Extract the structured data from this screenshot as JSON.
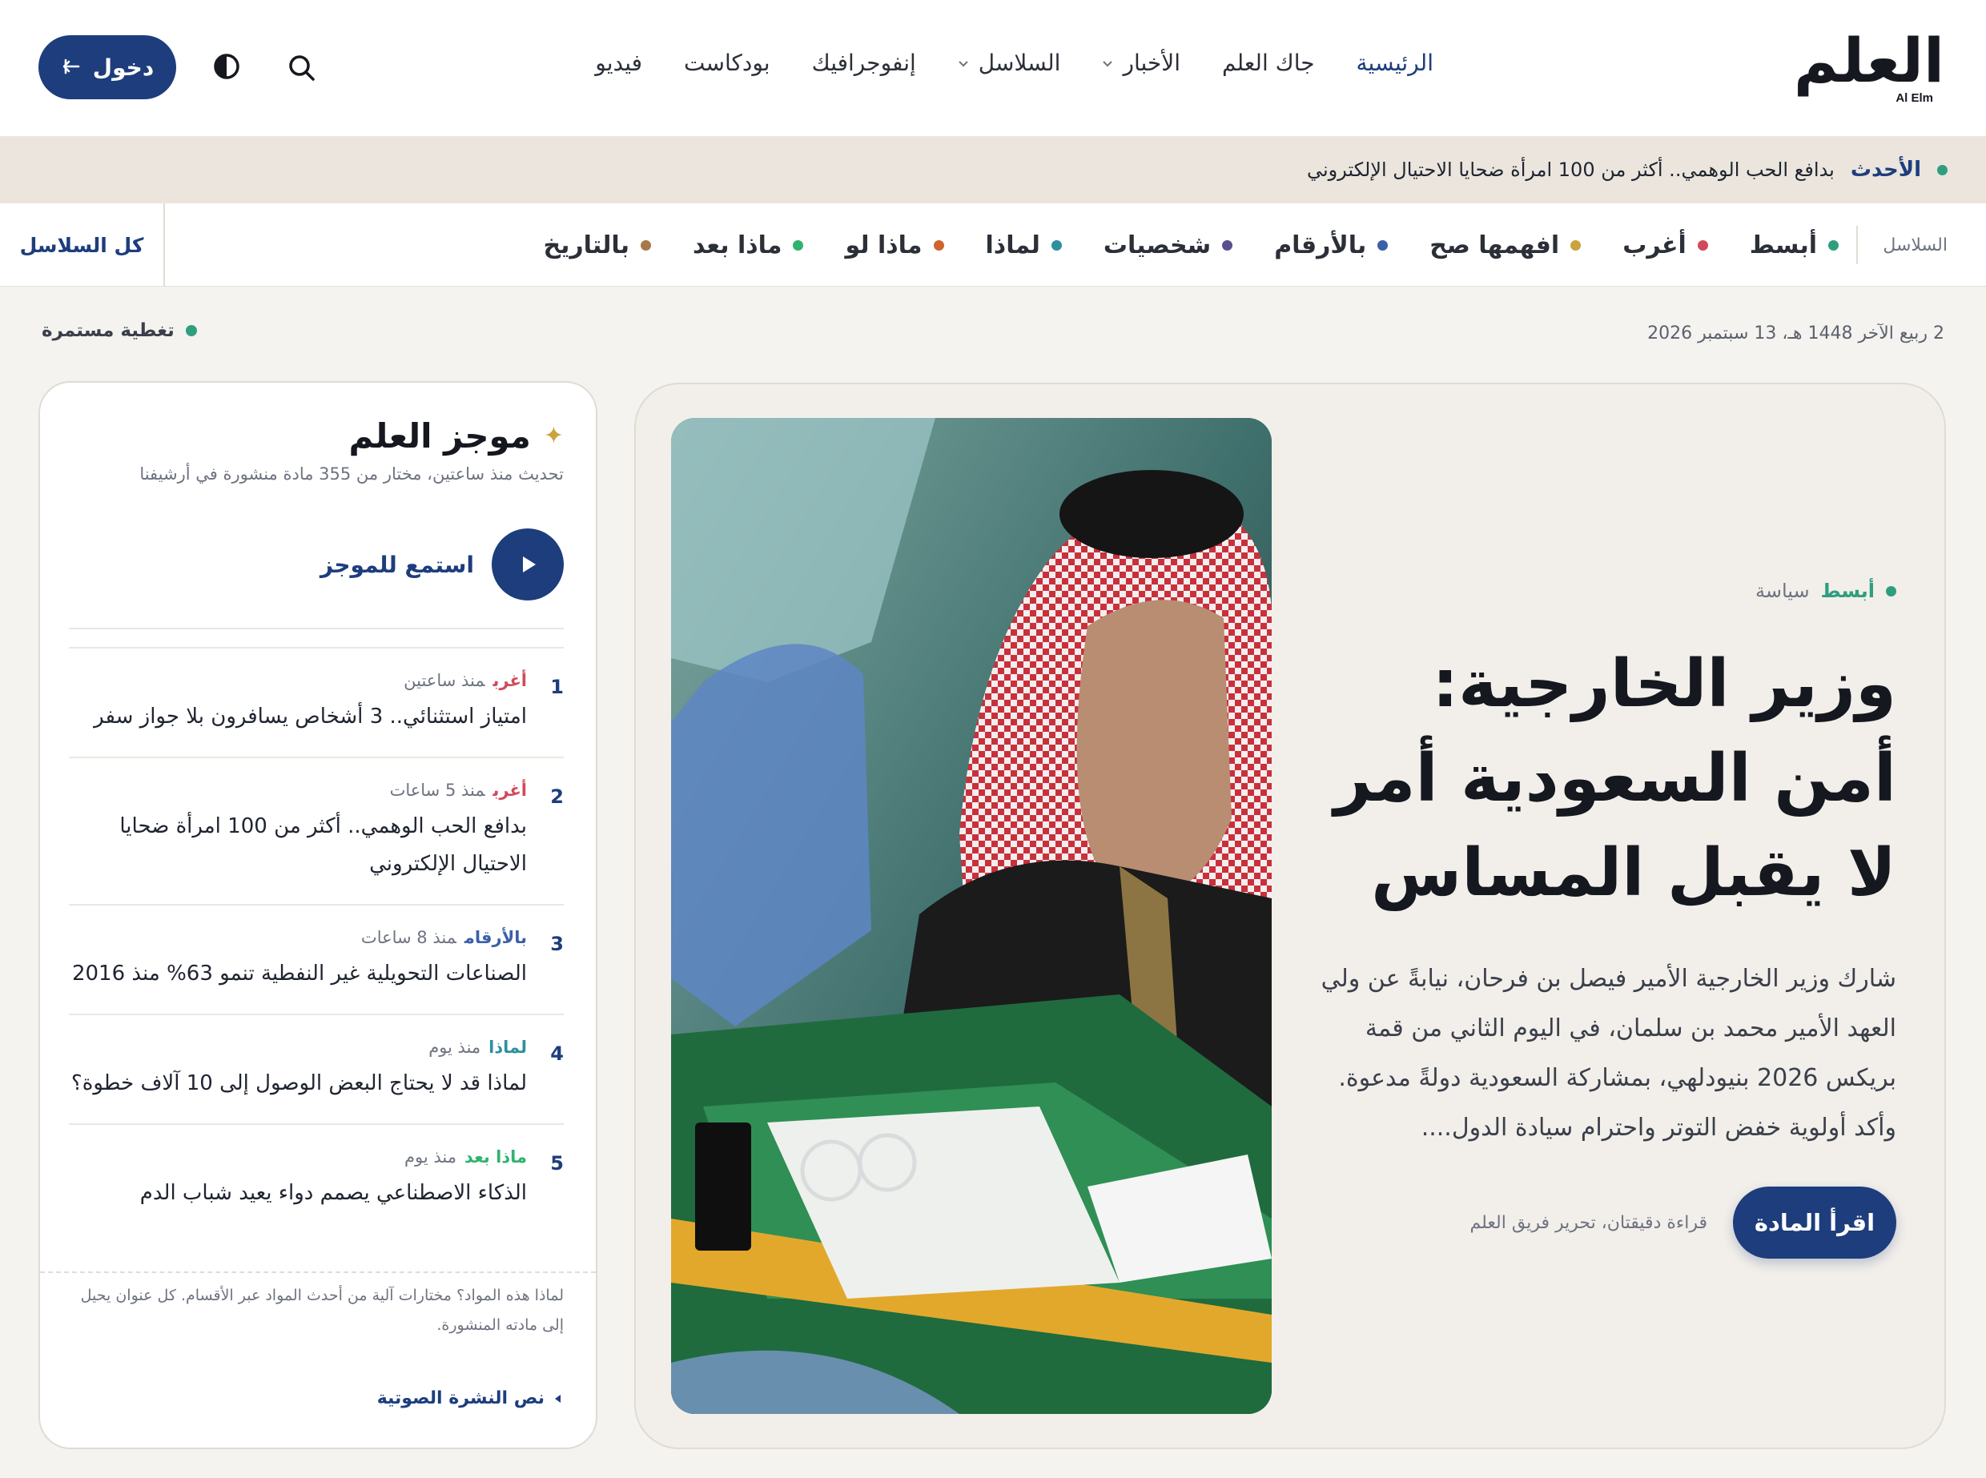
{
  "header": {
    "logo_ar": "العلم",
    "logo_en": "Al Elm",
    "nav": [
      {
        "label": "الرئيسية",
        "active": true,
        "dropdown": false
      },
      {
        "label": "جاك العلم",
        "active": false,
        "dropdown": false
      },
      {
        "label": "الأخبار",
        "active": false,
        "dropdown": true
      },
      {
        "label": "السلاسل",
        "active": false,
        "dropdown": true
      },
      {
        "label": "إنفوجرافيك",
        "active": false,
        "dropdown": false
      },
      {
        "label": "بودكاست",
        "active": false,
        "dropdown": false
      },
      {
        "label": "فيديو",
        "active": false,
        "dropdown": false
      }
    ],
    "login_label": "دخول",
    "icons": {
      "search": "search-icon",
      "theme": "contrast-icon",
      "login": "login-arrow-icon"
    }
  },
  "ticker": {
    "label": "الأحدث",
    "text": "بدافع الحب الوهمي.. أكثر من 100 امرأة ضحايا الاحتيال الإلكتروني",
    "dot_color": "#2f9e7e"
  },
  "series": {
    "label": "السلاسل",
    "items": [
      {
        "label": "أبسط",
        "color": "#2f9e7e"
      },
      {
        "label": "أغرب",
        "color": "#d04b5a"
      },
      {
        "label": "افهمها صح",
        "color": "#c9a33c"
      },
      {
        "label": "بالأرقام",
        "color": "#3b5fa8"
      },
      {
        "label": "شخصيات",
        "color": "#5b4e8c"
      },
      {
        "label": "لماذا",
        "color": "#2f8f9e"
      },
      {
        "label": "ماذا لو",
        "color": "#d0642e"
      },
      {
        "label": "ماذا بعد",
        "color": "#2fb36e"
      },
      {
        "label": "بالتاريخ",
        "color": "#a8784a"
      }
    ],
    "all_label": "كل السلاسل"
  },
  "meta": {
    "date": "2 ربيع الآخر 1448 هـ، 13 سبتمبر 2026",
    "live_label": "تغطية مستمرة",
    "live_color": "#2f9e7e"
  },
  "hero": {
    "series": "أبسط",
    "category": "سياسة",
    "title": "وزير الخارجية: أمن السعودية أمر لا يقبل المساس",
    "summary": "شارك وزير الخارجية الأمير فيصل بن فرحان، نيابةً عن ولي العهد الأمير محمد بن سلمان، في اليوم الثاني من قمة بريكس 2026 بنيودلهي، بمشاركة السعودية دولةً مدعوة. وأكد أولوية خفض التوتر واحترام سيادة الدول....",
    "read_label": "اقرأ المادة",
    "read_meta": "قراءة دقيقتان، تحرير فريق العلم"
  },
  "brief": {
    "title": "موجز العلم",
    "subtitle": "تحديث منذ ساعتين، مختار من 355 مادة منشورة في أرشيفنا",
    "listen_label": "استمع للموجز",
    "items": [
      {
        "num": "1",
        "series": "أغرب",
        "series_color": "#d04b5a",
        "time": "منذ ساعتين",
        "title": "امتياز استثنائي.. 3 أشخاص يسافرون بلا جواز سفر"
      },
      {
        "num": "2",
        "series": "أغرب",
        "series_color": "#d04b5a",
        "time": "منذ 5 ساعات",
        "title": "بدافع الحب الوهمي.. أكثر من 100 امرأة ضحايا الاحتيال الإلكتروني"
      },
      {
        "num": "3",
        "series": "بالأرقام",
        "series_color": "#3b5fa8",
        "time": "منذ 8 ساعات",
        "title": "الصناعات التحويلية غير النفطية تنمو 63% منذ 2016"
      },
      {
        "num": "4",
        "series": "لماذا",
        "series_color": "#2f8f9e",
        "time": "منذ يوم",
        "title": "لماذا قد لا يحتاج البعض الوصول إلى 10 آلاف خطوة؟"
      },
      {
        "num": "5",
        "series": "ماذا بعد",
        "series_color": "#2fb36e",
        "time": "منذ يوم",
        "title": "الذكاء الاصطناعي يصمم دواء يعيد شباب الدم"
      }
    ],
    "why": "لماذا هذه المواد؟ مختارات آلية من أحدث المواد عبر الأقسام. كل عنوان يحيل إلى مادته المنشورة.",
    "transcript_label": "نص النشرة الصوتية"
  }
}
